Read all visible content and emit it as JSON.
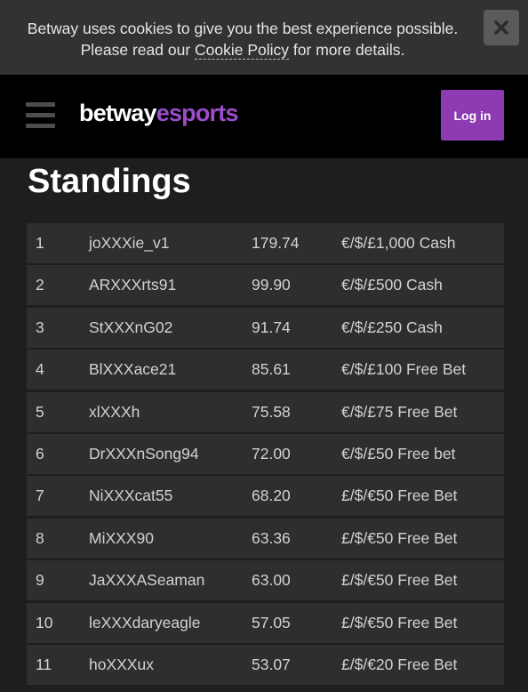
{
  "cookie": {
    "line1": "Betway uses cookies to give you the best experience possible.",
    "line2_before": "Please read our ",
    "link": "Cookie Policy",
    "line2_after": " for more details.",
    "close_icon": "close-x-icon"
  },
  "header": {
    "menu_icon": "hamburger-menu-icon",
    "logo_part1": "betway",
    "logo_part2": "esports",
    "login_label": "Log in",
    "brand_color": "#8e3ab3"
  },
  "title": "Standings",
  "standings": [
    {
      "rank": "1",
      "user": "joXXXie_v1",
      "score": "179.74",
      "prize": "€/$/£1,000 Cash"
    },
    {
      "rank": "2",
      "user": "ARXXXrts91",
      "score": "99.90",
      "prize": "€/$/£500 Cash"
    },
    {
      "rank": "3",
      "user": "StXXXnG02",
      "score": "91.74",
      "prize": "€/$/£250 Cash"
    },
    {
      "rank": "4",
      "user": "BlXXXace21",
      "score": "85.61",
      "prize": "€/$/£100 Free Bet"
    },
    {
      "rank": "5",
      "user": "xlXXXh",
      "score": "75.58",
      "prize": "€/$/£75 Free Bet"
    },
    {
      "rank": "6",
      "user": "DrXXXnSong94",
      "score": "72.00",
      "prize": "€/$/£50 Free bet"
    },
    {
      "rank": "7",
      "user": "NiXXXcat55",
      "score": "68.20",
      "prize": "£/$/€50 Free Bet"
    },
    {
      "rank": "8",
      "user": "MiXXX90",
      "score": "63.36",
      "prize": "£/$/€50 Free Bet"
    },
    {
      "rank": "9",
      "user": "JaXXXASeaman",
      "score": "63.00",
      "prize": "£/$/€50 Free Bet"
    },
    {
      "rank": "10",
      "user": "leXXXdaryeagle",
      "score": "57.05",
      "prize": "£/$/€50 Free Bet"
    },
    {
      "rank": "11",
      "user": "hoXXXux",
      "score": "53.07",
      "prize": "£/$/€20 Free Bet"
    }
  ]
}
